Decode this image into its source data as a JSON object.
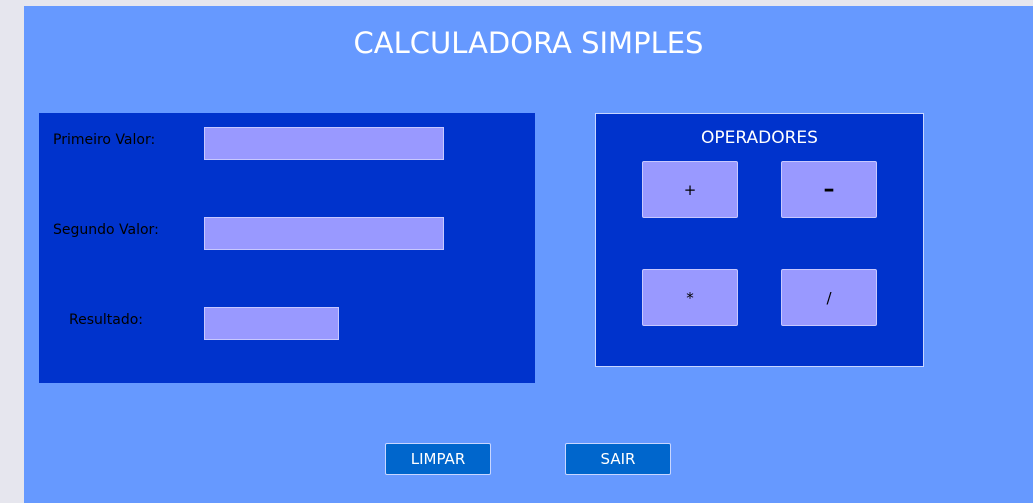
{
  "window": {
    "title": "CALCULADORA SIMPLES"
  },
  "inputs": {
    "first_label": "Primeiro Valor:",
    "first_value": "",
    "second_label": "Segundo Valor:",
    "second_value": "",
    "result_label": "Resultado:",
    "result_value": ""
  },
  "operators": {
    "title": "OPERADORES",
    "add": "+",
    "subtract": "–",
    "multiply": "*",
    "divide": "/"
  },
  "actions": {
    "clear_label": "LIMPAR",
    "exit_label": "SAIR"
  },
  "colors": {
    "background": "#6699ff",
    "panel": "#0033cc",
    "field": "#9999ff",
    "action_button": "#0066cc"
  }
}
